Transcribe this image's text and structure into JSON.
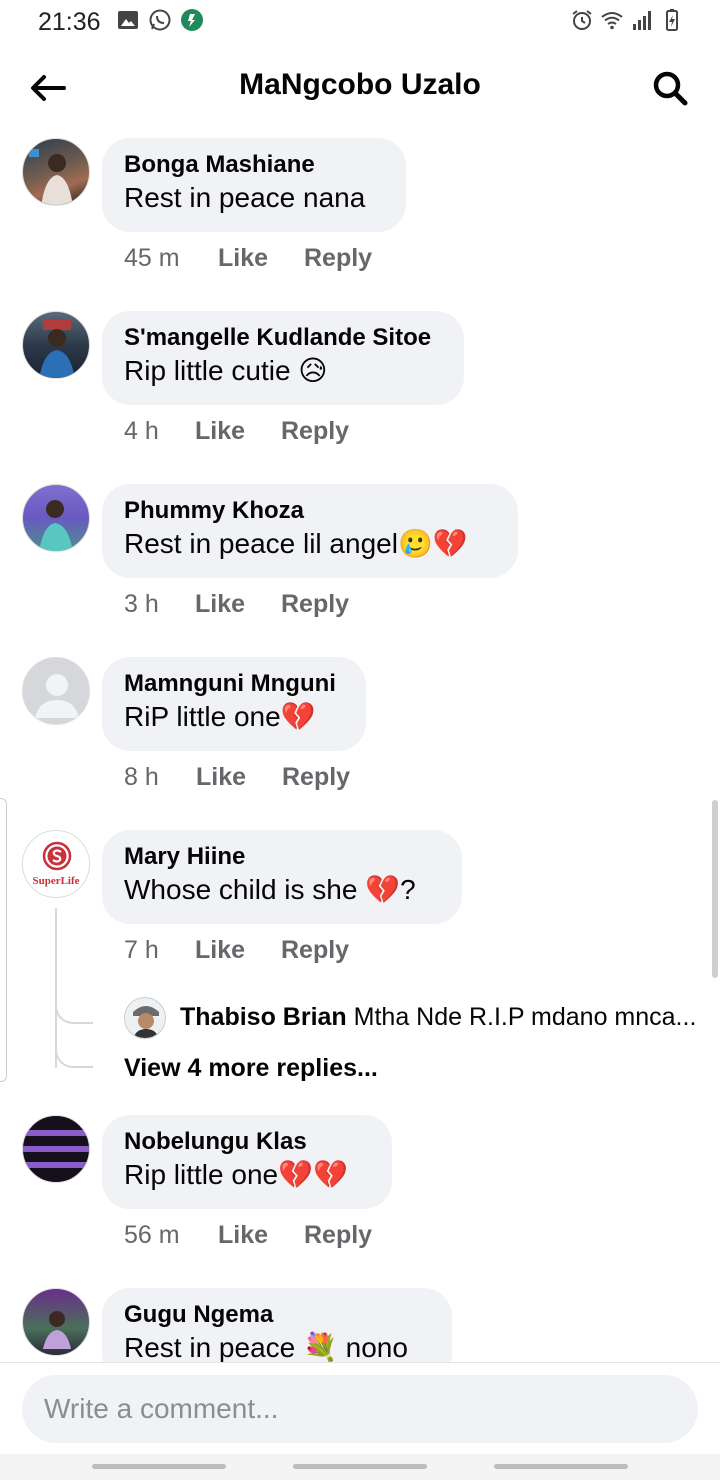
{
  "status_bar": {
    "time": "21:36"
  },
  "header": {
    "title": "MaNgcobo Uzalo"
  },
  "comments": [
    {
      "author": "Bonga Mashiane",
      "text": "Rest in peace nana",
      "time": "45 m",
      "like": "Like",
      "reply": "Reply"
    },
    {
      "author": "S'mangelle Kudlande Sitoe",
      "text": "Rip little cutie 😥",
      "time": "4 h",
      "like": "Like",
      "reply": "Reply"
    },
    {
      "author": "Phummy Khoza",
      "text": "Rest in peace lil angel🥲💔",
      "time": "3 h",
      "like": "Like",
      "reply": "Reply"
    },
    {
      "author": "Mamnguni Mnguni",
      "text": "RiP little one💔",
      "time": "8 h",
      "like": "Like",
      "reply": "Reply"
    },
    {
      "author": "Mary Hiine",
      "text": "Whose child is she 💔?",
      "time": "7 h",
      "like": "Like",
      "reply": "Reply",
      "avatar_brand": "SuperLife"
    },
    {
      "author": "Nobelungu Klas",
      "text": "Rip little one💔💔",
      "time": "56 m",
      "like": "Like",
      "reply": "Reply"
    },
    {
      "author": "Gugu Ngema",
      "text": "Rest in peace 💐 nono"
    }
  ],
  "reply_preview": {
    "author": "Thabiso Brian",
    "text": "Mtha Nde  R.I.P mdano mnca..."
  },
  "view_more": "View 4 more replies...",
  "composer": {
    "placeholder": "Write a comment..."
  },
  "colors": {
    "bubble": "#f0f2f5",
    "meta": "#65676b"
  }
}
